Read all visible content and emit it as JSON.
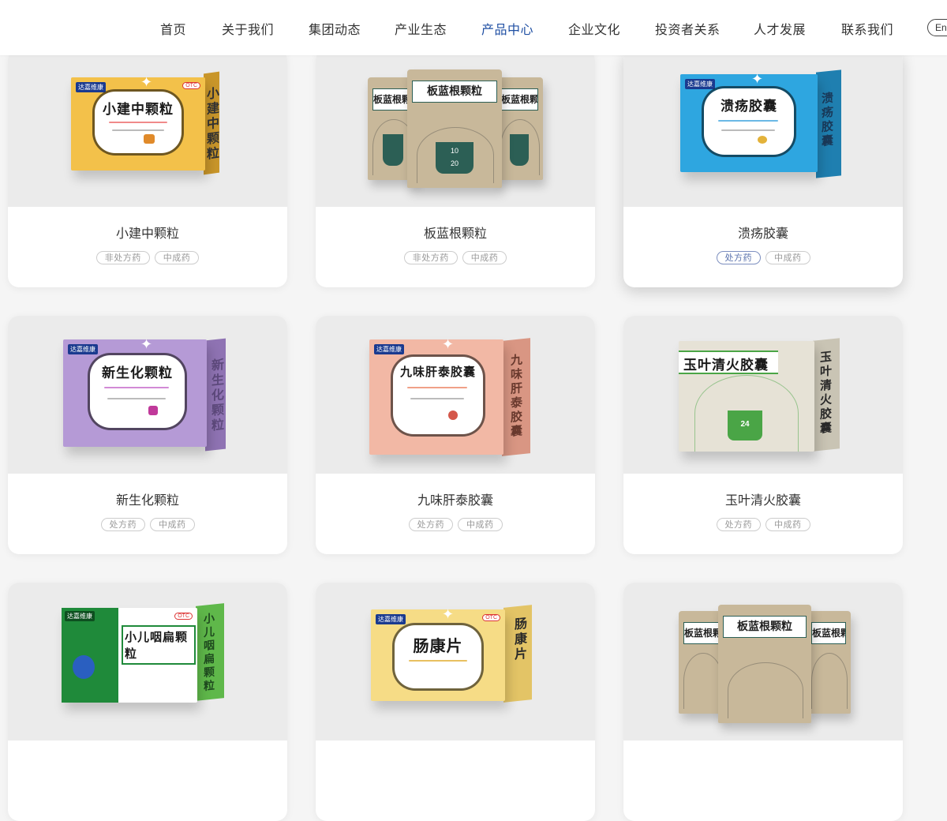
{
  "nav": {
    "items": [
      "首页",
      "关于我们",
      "集团动态",
      "产业生态",
      "产品中心",
      "企业文化",
      "投资者关系",
      "人才发展",
      "联系我们"
    ],
    "active_index": 4,
    "language_button": "Eng"
  },
  "products": [
    {
      "name": "小建中颗粒",
      "tags": [
        "非处方药",
        "中成药"
      ],
      "package_text": "小建中颗粒",
      "package_color": "#f3c14a",
      "side_color": "#c9962a",
      "brand": "达嘉维康",
      "otc": "OTC"
    },
    {
      "name": "板蓝根颗粒",
      "tags": [
        "非处方药",
        "中成药"
      ],
      "package_text": "板蓝根颗粒",
      "package_color": "#c8b89a",
      "pouch_numbers": [
        "10",
        "20"
      ]
    },
    {
      "name": "溃疡胶囊",
      "tags": [
        "处方药",
        "中成药"
      ],
      "package_text": "溃疡胶囊",
      "package_color": "#2ea6e0",
      "side_color": "#1f7fb0",
      "brand": "达嘉维康",
      "highlight_first_tag": true
    },
    {
      "name": "新生化颗粒",
      "tags": [
        "处方药",
        "中成药"
      ],
      "package_text": "新生化颗粒",
      "package_color": "#b59ad6",
      "side_color": "#8f73b3",
      "brand": "达嘉维康"
    },
    {
      "name": "九味肝泰胶囊",
      "tags": [
        "处方药",
        "中成药"
      ],
      "package_text": "九味肝泰胶囊",
      "package_color": "#f2b8a5",
      "side_color": "#d99683",
      "brand": "达嘉维康"
    },
    {
      "name": "玉叶清火胶囊",
      "tags": [
        "处方药",
        "中成药"
      ],
      "package_text": "玉叶清火胶囊",
      "package_color": "#e6e2d6",
      "side_color": "#c9c4b4",
      "accent": "#4aa546",
      "pouch_numbers": [
        "24"
      ]
    },
    {
      "name": "",
      "tags": [],
      "package_text": "小儿咽扁颗粒",
      "package_color": "#1f8a3a",
      "side_color": "#5fb84a",
      "brand": "达嘉维康",
      "otc": "OTC"
    },
    {
      "name": "",
      "tags": [],
      "package_text": "肠康片",
      "package_color": "#f6dc86",
      "side_color": "#e3c466",
      "brand": "达嘉维康",
      "otc": "OTC"
    },
    {
      "name": "",
      "tags": [],
      "package_text": "板蓝根颗粒",
      "package_color": "#c8b89a"
    }
  ],
  "colors": {
    "active_nav": "#1f4fa3",
    "page_bg": "#f5f5f5",
    "tag_border": "#cccccc"
  }
}
